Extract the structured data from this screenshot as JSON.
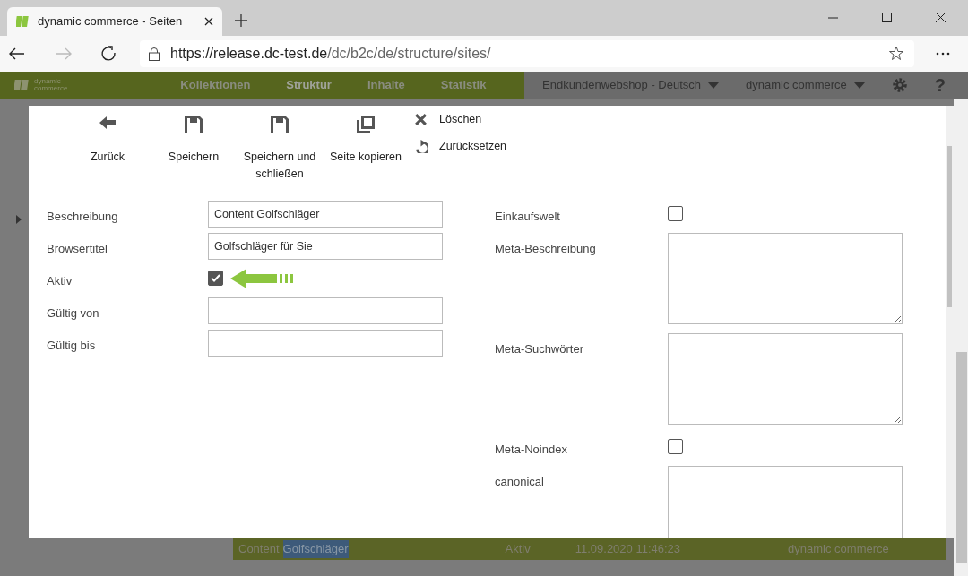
{
  "browser": {
    "tab_title": "dynamic commerce - Seiten",
    "url_host": "https://release.dc-test.de",
    "url_path": "/dc/b2c/de/structure/sites/"
  },
  "app_nav": {
    "logo_line1": "dynamic",
    "logo_line2": "commerce",
    "items": [
      {
        "label": "Kollektionen",
        "selected": false
      },
      {
        "label": "Struktur",
        "selected": true
      },
      {
        "label": "Inhalte",
        "selected": false
      },
      {
        "label": "Statistik",
        "selected": false
      }
    ],
    "shop_select": "Endkundenwebshop - Deutsch",
    "company_select": "dynamic commerce",
    "help": "?"
  },
  "toolbar": {
    "buttons": [
      {
        "label": "Zurück",
        "kind": "back"
      },
      {
        "label": "Speichern",
        "kind": "save"
      },
      {
        "label": "Speichern und schließen",
        "kind": "save"
      },
      {
        "label": "Seite kopieren",
        "kind": "copy"
      }
    ],
    "actions": [
      {
        "label": "Löschen",
        "kind": "delete"
      },
      {
        "label": "Zurücksetzen",
        "kind": "reset"
      }
    ]
  },
  "form_left": [
    {
      "label": "Beschreibung",
      "kind": "text",
      "value": "Content Golfschläger"
    },
    {
      "label": "Browsertitel",
      "kind": "text",
      "value": "Golfschläger für Sie"
    },
    {
      "label": "Aktiv",
      "kind": "checkbox",
      "checked": true,
      "pointer": true
    },
    {
      "label": "Gültig von",
      "kind": "text"
    },
    {
      "label": "Gültig bis",
      "kind": "text"
    }
  ],
  "form_right": [
    {
      "label": "Einkaufswelt",
      "kind": "checkbox",
      "checked": false
    },
    {
      "label": "Meta-Beschreibung",
      "kind": "textarea"
    },
    {
      "label": "Meta-Suchwörter",
      "kind": "textarea"
    },
    {
      "label": "Meta-Noindex",
      "kind": "checkbox",
      "checked": false
    },
    {
      "label": "canonical",
      "kind": "textarea"
    }
  ],
  "background_row": {
    "cells": [
      "Content",
      "Golfschläger",
      "Aktiv",
      "11.09.2020 11:46:23",
      "dynamic commerce"
    ]
  }
}
